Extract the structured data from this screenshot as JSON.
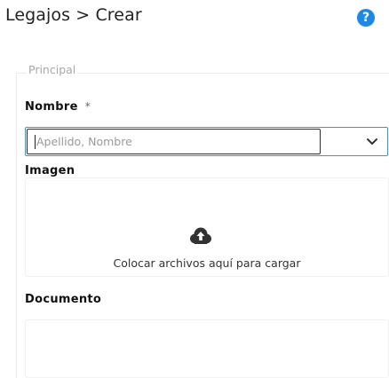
{
  "header": {
    "breadcrumb": "Legajos > Crear",
    "help_icon": "?"
  },
  "section": {
    "legend": "Principal"
  },
  "fields": {
    "nombre": {
      "label": "Nombre",
      "required_mark": "*",
      "placeholder": "Apellido, Nombre",
      "value": ""
    },
    "imagen": {
      "label": "Imagen",
      "dropzone_text": "Colocar archivos aquí para cargar",
      "icon": "cloud-upload-icon"
    },
    "documento": {
      "label": "Documento"
    }
  },
  "colors": {
    "accent": "#1e88e5",
    "focus_border": "#4a90c8",
    "placeholder": "#9a9a9a"
  }
}
